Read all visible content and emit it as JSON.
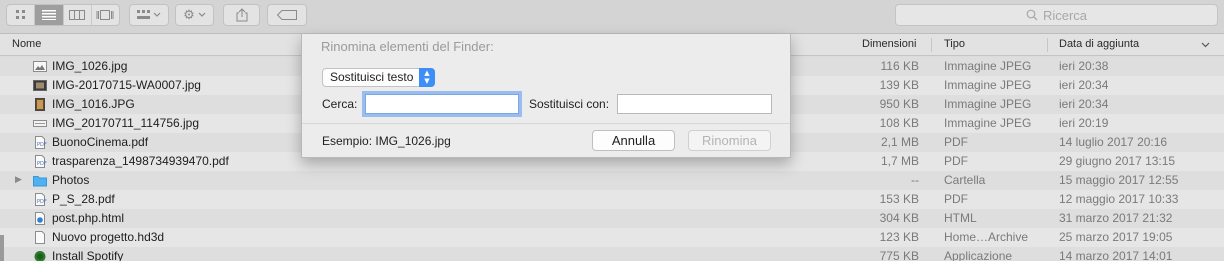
{
  "toolbar": {
    "view_buttons": [
      "icons-view-icon",
      "list-view-icon",
      "columns-view-icon",
      "gallery-view-icon"
    ],
    "active_view": "list-view-icon",
    "search_placeholder": "Ricerca"
  },
  "columns": {
    "name": "Nome",
    "size": "Dimensioni",
    "kind": "Tipo",
    "date_added": "Data di aggiunta"
  },
  "files": [
    {
      "name": "IMG_1026.jpg",
      "size": "116 KB",
      "kind": "Immagine JPEG",
      "date": "ieri 20:38",
      "icon": "image-file-icon"
    },
    {
      "name": "IMG-20170715-WA0007.jpg",
      "size": "139 KB",
      "kind": "Immagine JPEG",
      "date": "ieri 20:34",
      "icon": "image-file-icon"
    },
    {
      "name": "IMG_1016.JPG",
      "size": "950 KB",
      "kind": "Immagine JPEG",
      "date": "ieri 20:34",
      "icon": "image-file-icon"
    },
    {
      "name": "IMG_20170711_114756.jpg",
      "size": "108 KB",
      "kind": "Immagine JPEG",
      "date": "ieri 20:19",
      "icon": "image-file-icon"
    },
    {
      "name": "BuonoCinema.pdf",
      "size": "2,1 MB",
      "kind": "PDF",
      "date": "14 luglio 2017 20:16",
      "icon": "pdf-file-icon"
    },
    {
      "name": "trasparenza_1498734939470.pdf",
      "size": "1,7 MB",
      "kind": "PDF",
      "date": "29 giugno 2017 13:15",
      "icon": "pdf-file-icon"
    },
    {
      "name": "Photos",
      "size": "--",
      "kind": "Cartella",
      "date": "15 maggio 2017 12:55",
      "icon": "folder-icon"
    },
    {
      "name": "P_S_28.pdf",
      "size": "153 KB",
      "kind": "PDF",
      "date": "12 maggio 2017 10:33",
      "icon": "pdf-file-icon"
    },
    {
      "name": "post.php.html",
      "size": "304 KB",
      "kind": "HTML",
      "date": "31 marzo 2017 21:32",
      "icon": "html-file-icon"
    },
    {
      "name": "Nuovo progetto.hd3d",
      "size": "123 KB",
      "kind": "Home…Archive",
      "date": "25 marzo 2017 19:05",
      "icon": "document-icon"
    },
    {
      "name": "Install Spotify",
      "size": "775 KB",
      "kind": "Applicazione",
      "date": "14 marzo 2017 14:01",
      "icon": "app-icon"
    }
  ],
  "dialog": {
    "title": "Rinomina elementi del Finder:",
    "mode": "Sostituisci testo",
    "find_label": "Cerca:",
    "find_value": "",
    "replace_label": "Sostituisci con:",
    "replace_value": "",
    "example": "Esempio: IMG_1026.jpg",
    "cancel_label": "Annulla",
    "rename_label": "Rinomina"
  },
  "colors": {
    "accent": "#3d8ef7",
    "focus_ring": "#5996f0",
    "folder": "#4fb2f0"
  }
}
